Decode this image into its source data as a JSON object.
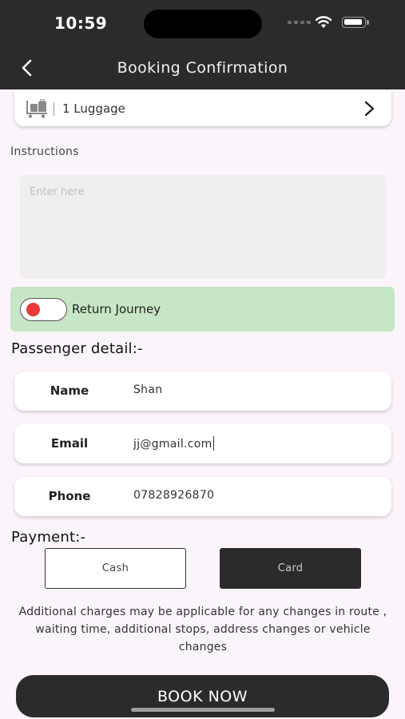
{
  "status_bar": {
    "time": "10:59"
  },
  "header": {
    "title": "Booking Confirmation",
    "back_icon": "chevron-left-icon"
  },
  "luggage": {
    "icon": "luggage-cart-icon",
    "label": "1 Luggage",
    "chevron_icon": "chevron-right-icon"
  },
  "instructions": {
    "label": "Instructions",
    "placeholder": "Enter here",
    "value": ""
  },
  "return_journey": {
    "label": "Return Journey",
    "enabled": false,
    "knob_color": "#ea3a3a",
    "background": "#c6e6c5"
  },
  "passenger": {
    "heading": "Passenger detail:-",
    "fields": [
      {
        "label": "Name",
        "value": "Shan"
      },
      {
        "label": "Email",
        "value": "jj@gmail.com"
      },
      {
        "label": "Phone",
        "value": "07828926870"
      }
    ]
  },
  "payment": {
    "heading": "Payment:-",
    "options": [
      "Cash",
      "Card"
    ],
    "selected": "Card"
  },
  "note": "Additional charges may be applicable for any changes in route , waiting time, additional stops, address changes or vehicle changes",
  "book_button": "BOOK NOW",
  "colors": {
    "dark": "#2b2b2b",
    "background": "#fbf5fb"
  }
}
